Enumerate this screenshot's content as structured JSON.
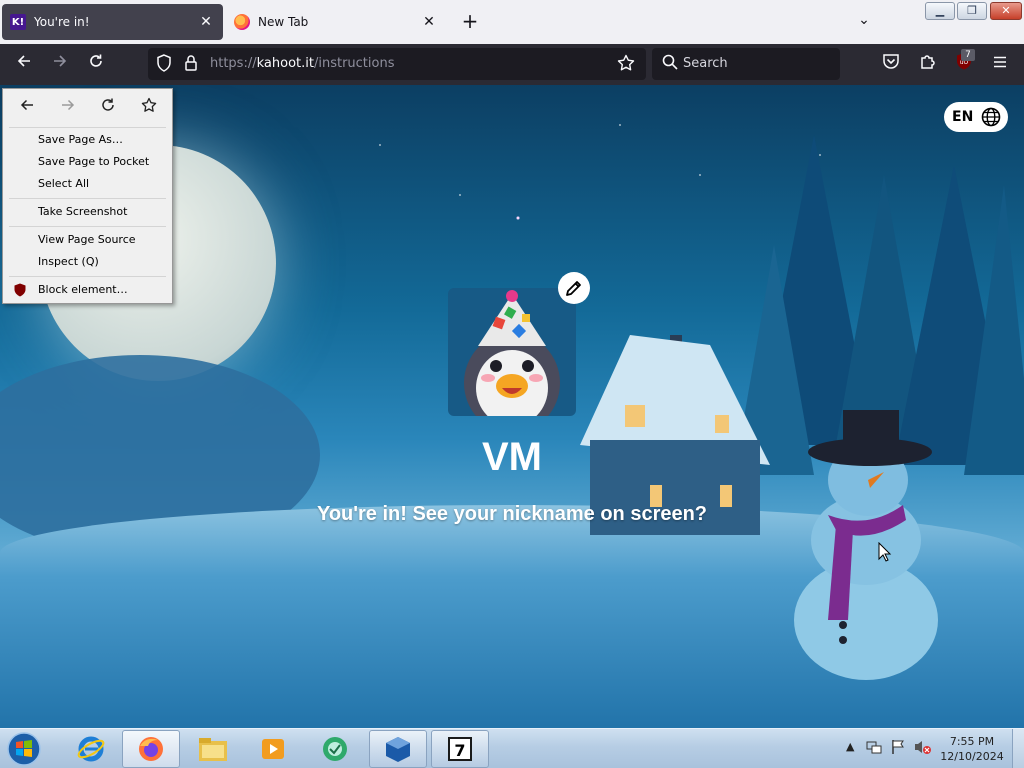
{
  "browser": {
    "tabs": [
      {
        "title": "You're in!",
        "favicon": "K!",
        "active": true
      },
      {
        "title": "New Tab",
        "favicon": "firefox-icon",
        "active": false
      }
    ],
    "new_tab_label": "+",
    "url": {
      "prefix": "https://",
      "host": "kahoot.it",
      "path": "/instructions"
    },
    "search_placeholder": "Search",
    "ublock_count": "7"
  },
  "context_menu": {
    "items": [
      "Save Page As…",
      "Save Page to Pocket",
      "Select All",
      "Take Screenshot",
      "View Page Source",
      "Inspect (Q)",
      "Block element…"
    ]
  },
  "page": {
    "language": "EN",
    "nickname": "VM",
    "message": "You're in! See your nickname on screen?",
    "brand_color": "#46178f"
  },
  "taskbar": {
    "apps": [
      "internet-explorer-icon",
      "firefox-icon",
      "file-explorer-icon",
      "media-player-icon",
      "network-app-icon",
      "virtualbox-icon",
      "7zip-icon"
    ],
    "clock_time": "7:55 PM",
    "clock_date": "12/10/2024"
  }
}
